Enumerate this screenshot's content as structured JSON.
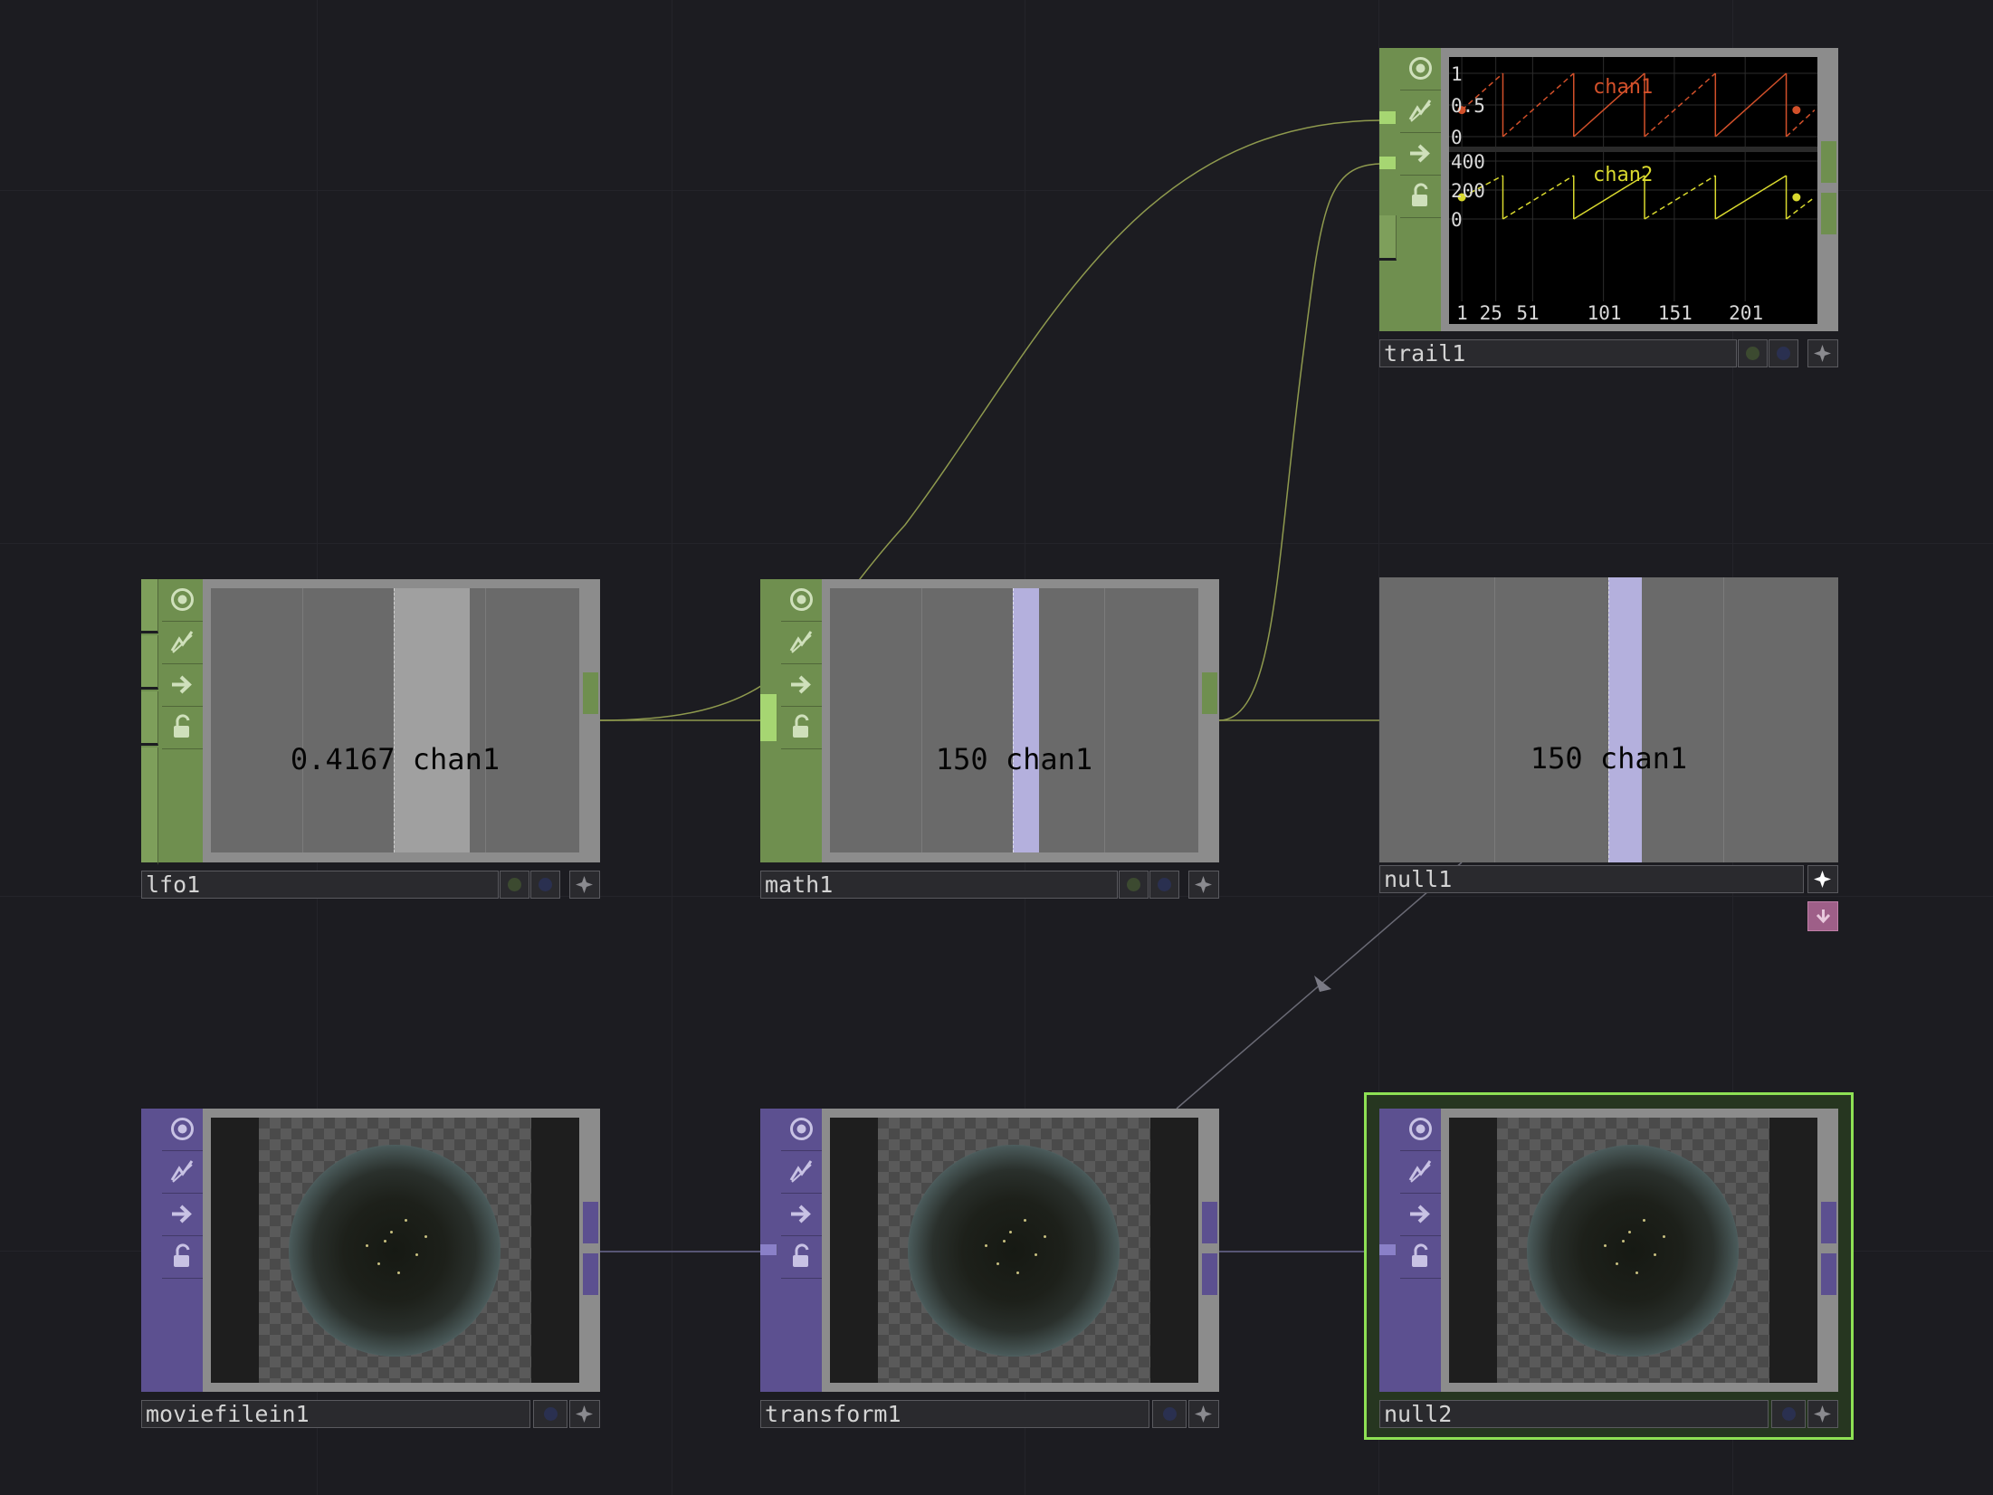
{
  "colors": {
    "chop_green": "#6f8f4f",
    "chop_green_light": "#a6d672",
    "top_purple": "#5c5090",
    "selection_outline": "#8ee054",
    "chan1_red": "#d2502a",
    "chan2_yellow": "#d9d92e",
    "bar_lavender": "#b4b0dd",
    "wire_chop": "#8f9a4e",
    "wire_top": "#6a6790"
  },
  "node_icons": [
    "viewer-active-icon",
    "bypass-icon",
    "display-flag-icon",
    "lock-icon"
  ],
  "nodes": {
    "lfo1": {
      "name": "lfo1",
      "value": "0.4167",
      "channel": "chan1",
      "level": 0.4167
    },
    "math1": {
      "name": "math1",
      "value": "150",
      "channel": "chan1"
    },
    "null1": {
      "name": "null1",
      "value": "150",
      "channel": "chan1"
    },
    "trail1": {
      "name": "trail1"
    },
    "moviefilein1": {
      "name": "moviefilein1"
    },
    "transform1": {
      "name": "transform1"
    },
    "null2": {
      "name": "null2"
    }
  },
  "chart_data": [
    {
      "type": "line",
      "series": [
        {
          "name": "chan1",
          "color": "#d2502a"
        }
      ],
      "y_ticks": [
        "1",
        "0.5",
        "0"
      ],
      "ylim": [
        0,
        1
      ],
      "x": [
        1,
        30,
        30,
        80,
        80,
        130,
        130,
        180,
        180,
        230,
        230,
        250
      ],
      "y": [
        0.42,
        1,
        0,
        1,
        0,
        1,
        0,
        1,
        0,
        1,
        0,
        0.42
      ]
    },
    {
      "type": "line",
      "series": [
        {
          "name": "chan2",
          "color": "#d9d92e"
        }
      ],
      "y_ticks": [
        "400",
        "200",
        "0"
      ],
      "ylim": [
        0,
        400
      ],
      "x": [
        1,
        30,
        30,
        80,
        80,
        130,
        130,
        180,
        180,
        230,
        230,
        250
      ],
      "y": [
        150,
        300,
        0,
        300,
        0,
        300,
        0,
        300,
        0,
        300,
        0,
        150
      ],
      "x_ticks": [
        "1",
        "51",
        "101",
        "151",
        "201",
        "25"
      ],
      "xlim": [
        -8,
        252
      ]
    }
  ]
}
